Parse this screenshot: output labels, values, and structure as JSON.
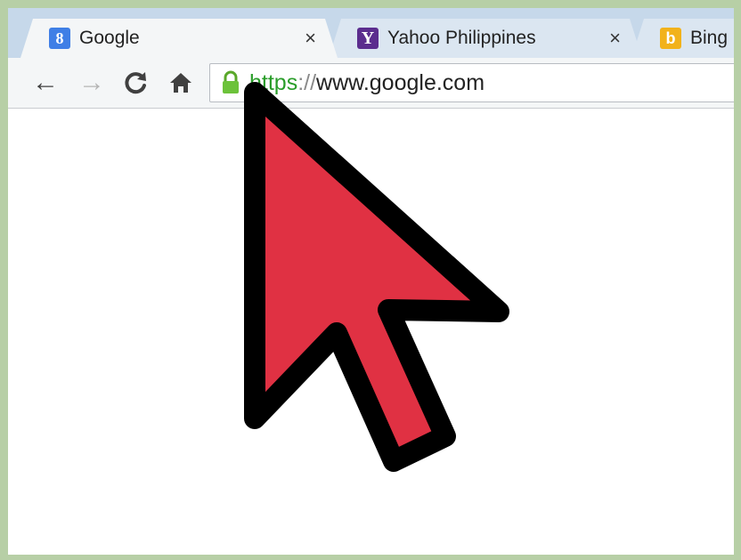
{
  "tabs": [
    {
      "title": "Google",
      "favicon": "google-favicon",
      "favicon_glyph": "8",
      "active": true
    },
    {
      "title": "Yahoo Philippines",
      "favicon": "yahoo-favicon",
      "favicon_glyph": "Y",
      "active": false
    },
    {
      "title": "Bing",
      "favicon": "bing-favicon",
      "favicon_glyph": "b",
      "active": false
    }
  ],
  "tab_close_glyph": "×",
  "toolbar": {
    "back_glyph": "←",
    "forward_glyph": "→",
    "reload_glyph": "C",
    "home_glyph": "⌂"
  },
  "omnibox": {
    "url_scheme": "https",
    "url_separator": "://",
    "url_host": "www.google.com",
    "secure": true
  },
  "cursor": {
    "color": "#e03143",
    "outline": "#000000"
  },
  "colors": {
    "frame_border": "#b7cfa6",
    "secure_green": "#2a9d2a"
  }
}
